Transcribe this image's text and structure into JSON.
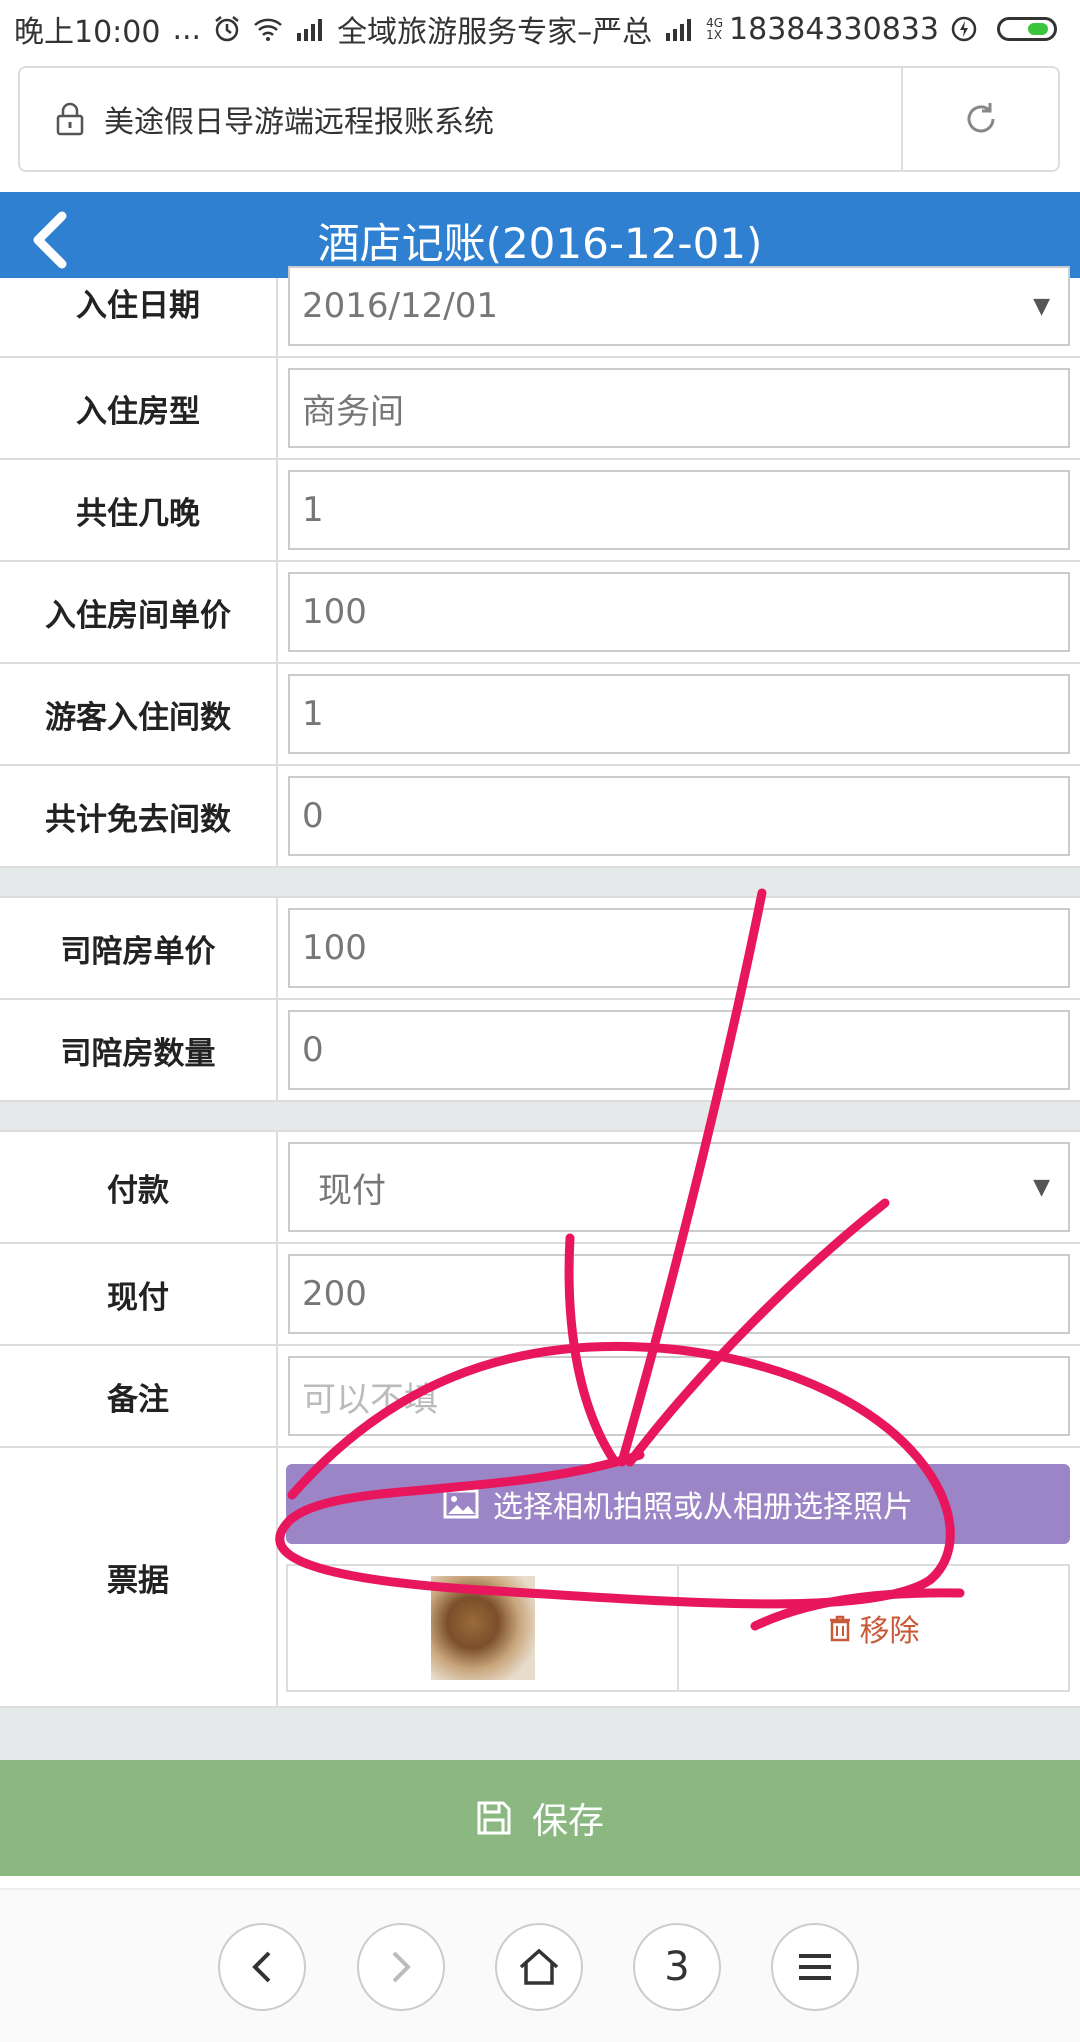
{
  "status_bar": {
    "time": "晚上10:00",
    "dots": "...",
    "carrier": "全域旅游服务专家–严总",
    "network_top": "4G",
    "network_bottom": "1X",
    "phone": "18384330833"
  },
  "browser": {
    "title": "美途假日导游端远程报账系统",
    "tab_count": "3"
  },
  "header": {
    "title": "酒店记账(2016-12-01)"
  },
  "form": {
    "checkin_date": {
      "label": "入住日期",
      "value": "2016/12/01"
    },
    "room_type": {
      "label": "入住房型",
      "value": "商务间"
    },
    "nights": {
      "label": "共住几晚",
      "value": "1"
    },
    "room_price": {
      "label": "入住房间单价",
      "value": "100"
    },
    "rooms": {
      "label": "游客入住间数",
      "value": "1"
    },
    "free_rooms": {
      "label": "共计免去间数",
      "value": "0"
    },
    "driver_price": {
      "label": "司陪房单价",
      "value": "100"
    },
    "driver_rooms": {
      "label": "司陪房数量",
      "value": "0"
    },
    "payment": {
      "label": "付款",
      "value": "现付"
    },
    "cash": {
      "label": "现付",
      "value": "200"
    },
    "remark": {
      "label": "备注",
      "placeholder": "可以不填"
    },
    "receipt": {
      "label": "票据",
      "photo_button": "选择相机拍照或从相册选择照片",
      "remove": "移除"
    }
  },
  "save_label": "保存",
  "colors": {
    "header": "#2f80d1",
    "photo_button": "#9b85c6",
    "save_bar": "#8ab880",
    "annotation": "#e8175d"
  }
}
